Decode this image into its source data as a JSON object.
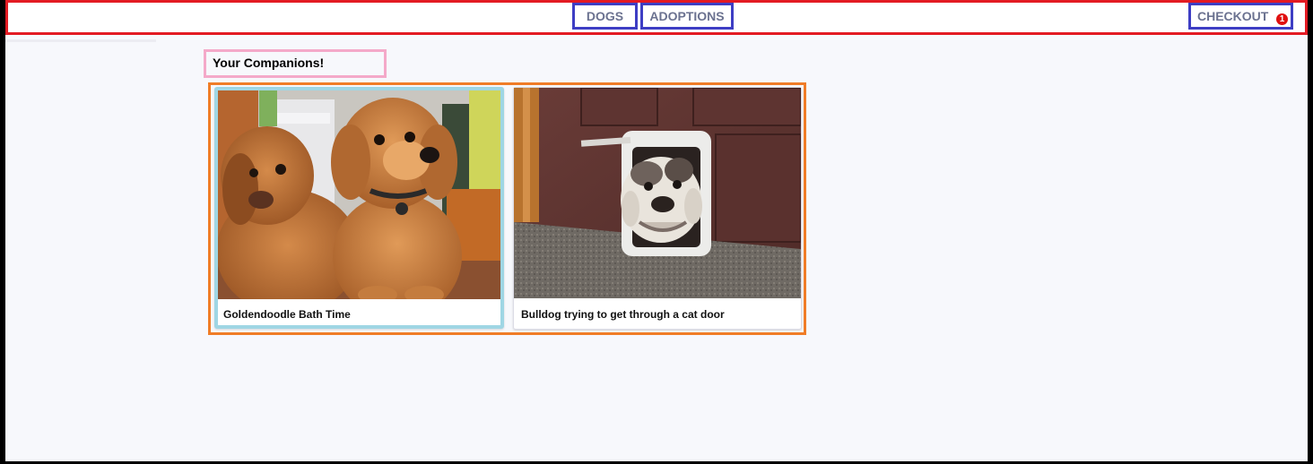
{
  "nav": {
    "dogs": "DOGS",
    "adoptions": "ADOPTIONS",
    "checkout": "CHECKOUT",
    "cart_count": "1"
  },
  "page": {
    "heading": "Your Companions!"
  },
  "gallery": {
    "items": [
      {
        "caption": "Goldendoodle Bath Time",
        "image": "goldendoodle-photo"
      },
      {
        "caption": "Bulldog trying to get through a cat door",
        "image": "bulldog-photo"
      }
    ]
  },
  "colors": {
    "nav_border": "#e31b23",
    "nav_item_border": "#3e3ec4",
    "heading_border": "#f4a9c9",
    "gallery_border": "#f07d27",
    "selected_card_border": "#9fd6e4",
    "badge": "#e01010"
  }
}
